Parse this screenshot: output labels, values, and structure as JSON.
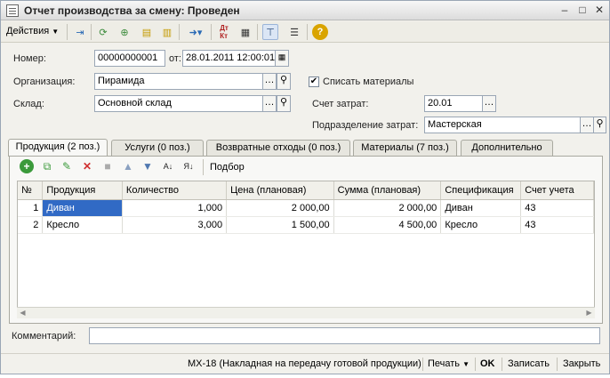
{
  "window": {
    "title": "Отчет производства за смену: Проведен"
  },
  "toolbar": {
    "actions_menu": "Действия"
  },
  "form": {
    "number_label": "Номер:",
    "number_value": "00000000001",
    "date_label": "от:",
    "date_value": "28.01.2011 12:00:01",
    "org_label": "Организация:",
    "org_value": "Пирамида",
    "warehouse_label": "Склад:",
    "warehouse_value": "Основной склад",
    "writeoff_label": "Списать материалы",
    "writeoff_checked": true,
    "cost_account_label": "Счет затрат:",
    "cost_account_value": "20.01",
    "cost_division_label": "Подразделение затрат:",
    "cost_division_value": "Мастерская"
  },
  "tabs": [
    {
      "label": "Продукция (2 поз.)",
      "active": true
    },
    {
      "label": "Услуги (0 поз.)"
    },
    {
      "label": "Возвратные отходы (0 поз.)"
    },
    {
      "label": "Материалы (7 поз.)"
    },
    {
      "label": "Дополнительно"
    }
  ],
  "subtoolbar": {
    "pick_label": "Подбор"
  },
  "table": {
    "columns": [
      "№",
      "Продукция",
      "Количество",
      "Цена (плановая)",
      "Сумма (плановая)",
      "Спецификация",
      "Счет учета"
    ],
    "rows": [
      [
        "1",
        "Диван",
        "1,000",
        "2 000,00",
        "2 000,00",
        "Диван",
        "43"
      ],
      [
        "2",
        "Кресло",
        "3,000",
        "1 500,00",
        "4 500,00",
        "Кресло",
        "43"
      ]
    ]
  },
  "comment": {
    "label": "Комментарий:",
    "value": ""
  },
  "statusbar": {
    "doc_print": "МХ-18 (Накладная на передачу готовой продукции)",
    "print": "Печать",
    "ok": "OK",
    "save": "Записать",
    "close": "Закрыть"
  },
  "colors": {
    "selection": "#316ac5",
    "window_bg": "#f2f1ec"
  }
}
